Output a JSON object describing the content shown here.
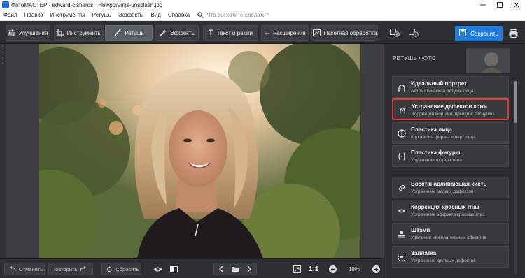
{
  "window": {
    "title": "ФотоМАСТЕР - edward-cisneros-_H6wpor9mjs-unsplash.jpg"
  },
  "menu": {
    "items": [
      "Файл",
      "Правка",
      "Инструменты",
      "Ретушь",
      "Эффекты",
      "Вид",
      "Справка"
    ],
    "search_placeholder": "Что вы хотите сделать?"
  },
  "toolbar": {
    "tabs": [
      {
        "label": "Улучшения",
        "icon": "sliders-icon"
      },
      {
        "label": "Инструменты",
        "icon": "crop-icon"
      },
      {
        "label": "Ретушь",
        "icon": "brush-icon",
        "active": true
      },
      {
        "label": "Эффекты",
        "icon": "sparkle-icon"
      },
      {
        "label": "Текст и рамки",
        "icon": "text-icon"
      },
      {
        "label": "Расширения",
        "icon": "plus-icon"
      },
      {
        "label": "Пакетная обработка",
        "icon": "batch-icon"
      }
    ],
    "save_label": "Сохранить",
    "accent_color": "#1f7ad9"
  },
  "panel": {
    "title": "РЕТУШЬ ФОТО",
    "group1": [
      {
        "title": "Идеальный портрет",
        "subtitle": "Автоматическая ретушь лица",
        "icon": "portrait-icon"
      },
      {
        "title": "Устранение дефектов кожи",
        "subtitle": "Коррекция морщин, прыщей, веснушек",
        "icon": "skin-icon",
        "selected": true
      },
      {
        "title": "Пластика лица",
        "subtitle": "Коррекция формы и черт лица",
        "icon": "face-shape-icon"
      },
      {
        "title": "Пластика фигуры",
        "subtitle": "Улучшение формы тела",
        "icon": "figure-icon"
      }
    ],
    "group2": [
      {
        "title": "Восстанавливающая кисть",
        "subtitle": "Устранение мелких дефектов",
        "icon": "healing-brush-icon"
      },
      {
        "title": "Коррекция красных глаз",
        "subtitle": "Устранение эффекта красных глаз",
        "icon": "eye-icon"
      },
      {
        "title": "Штамп",
        "subtitle": "Удаление нежелательных объектов",
        "icon": "stamp-icon"
      },
      {
        "title": "Заплатка",
        "subtitle": "Устранение крупных дефектов",
        "icon": "patch-icon"
      }
    ],
    "selection_color": "#e53a32"
  },
  "bottom": {
    "undo_label": "Отменить",
    "redo_label": "Повторить",
    "reset_label": "Сбросить",
    "ratio_label": "1:1",
    "zoom_value": "19%"
  }
}
